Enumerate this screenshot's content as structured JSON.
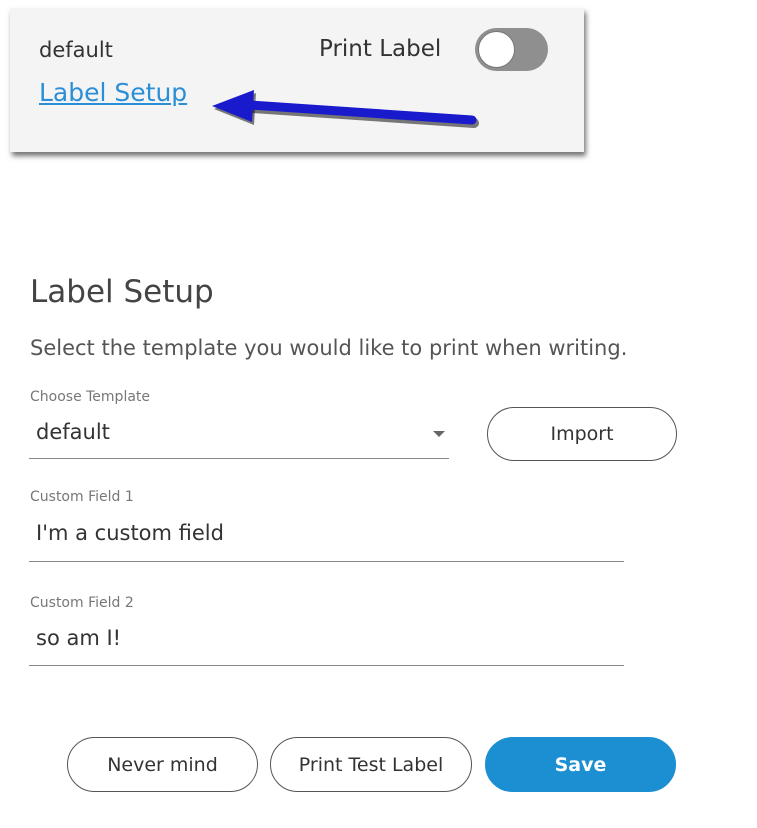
{
  "top_card": {
    "template_name": "default",
    "print_label_text": "Print Label",
    "print_label_enabled": false,
    "label_setup_link": "Label Setup"
  },
  "dialog": {
    "title": "Label Setup",
    "description": "Select the template you would like to print when writing.",
    "template_field": {
      "label": "Choose Template",
      "value": "default"
    },
    "import_button": "Import",
    "custom_field_1": {
      "label": "Custom Field 1",
      "value": "I'm a custom field"
    },
    "custom_field_2": {
      "label": "Custom Field 2",
      "value": "so am I!"
    },
    "buttons": {
      "never_mind": "Never mind",
      "print_test_label": "Print Test Label",
      "save": "Save"
    }
  },
  "colors": {
    "primary": "#1b8fd2",
    "link": "#2a8fd6",
    "annotation_arrow": "#1a1acd",
    "toggle_off": "#8f8f8f"
  }
}
